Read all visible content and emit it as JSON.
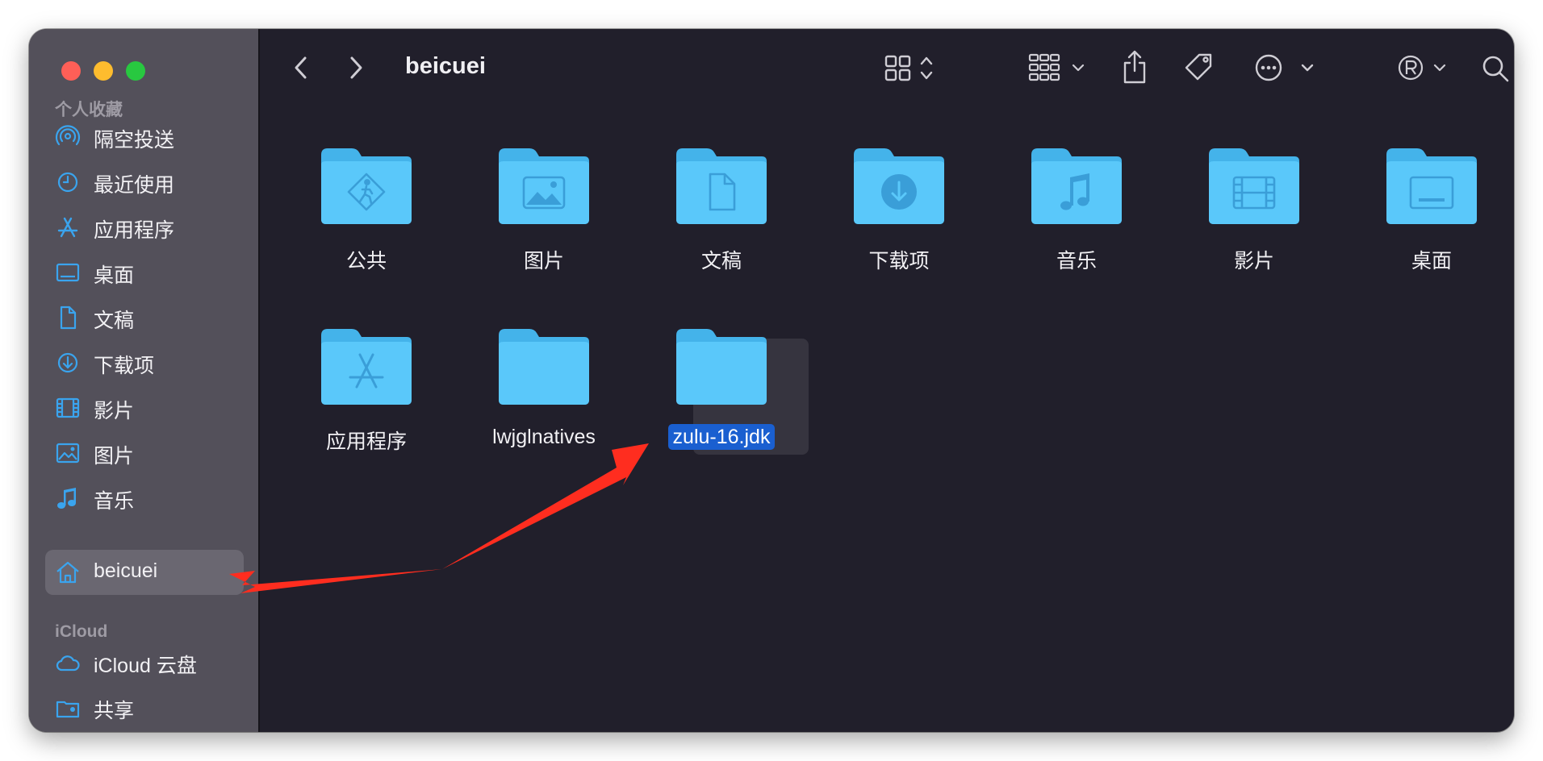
{
  "toolbar": {
    "path_title": "beicuei"
  },
  "sidebar": {
    "favorites_title": "个人收藏",
    "favorites": [
      {
        "label": "隔空投送",
        "icon": "airdrop-icon"
      },
      {
        "label": "最近使用",
        "icon": "clock-icon"
      },
      {
        "label": "应用程序",
        "icon": "applications-icon"
      },
      {
        "label": "桌面",
        "icon": "desktop-icon"
      },
      {
        "label": "文稿",
        "icon": "document-icon"
      },
      {
        "label": "下载项",
        "icon": "download-icon"
      },
      {
        "label": "影片",
        "icon": "film-icon"
      },
      {
        "label": "图片",
        "icon": "photo-icon"
      },
      {
        "label": "音乐",
        "icon": "music-note-icon"
      },
      {
        "label": "beicuei",
        "icon": "home-icon",
        "selected": true
      }
    ],
    "icloud_title": "iCloud",
    "icloud": [
      {
        "label": "iCloud 云盘",
        "icon": "cloud-icon"
      },
      {
        "label": "共享",
        "icon": "shared-folder-icon"
      }
    ]
  },
  "content": {
    "items": [
      {
        "label": "公共",
        "emblem": "public-emblem-icon"
      },
      {
        "label": "图片",
        "emblem": "photo-emblem-icon"
      },
      {
        "label": "文稿",
        "emblem": "document-emblem-icon"
      },
      {
        "label": "下载项",
        "emblem": "download-emblem-icon"
      },
      {
        "label": "音乐",
        "emblem": "music-emblem-icon"
      },
      {
        "label": "影片",
        "emblem": "film-emblem-icon"
      },
      {
        "label": "桌面",
        "emblem": "desktop-emblem-icon"
      },
      {
        "label": "应用程序",
        "emblem": "applications-emblem-icon"
      },
      {
        "label": "lwjglnatives",
        "emblem": ""
      },
      {
        "label": "zulu-16.jdk",
        "emblem": "",
        "selected": true
      }
    ]
  },
  "colors": {
    "accent": "#1a5fd0",
    "sidebar_icon": "#3aa4ee",
    "folder": "#5ac8fa",
    "annotation": "#ff2d1f"
  }
}
